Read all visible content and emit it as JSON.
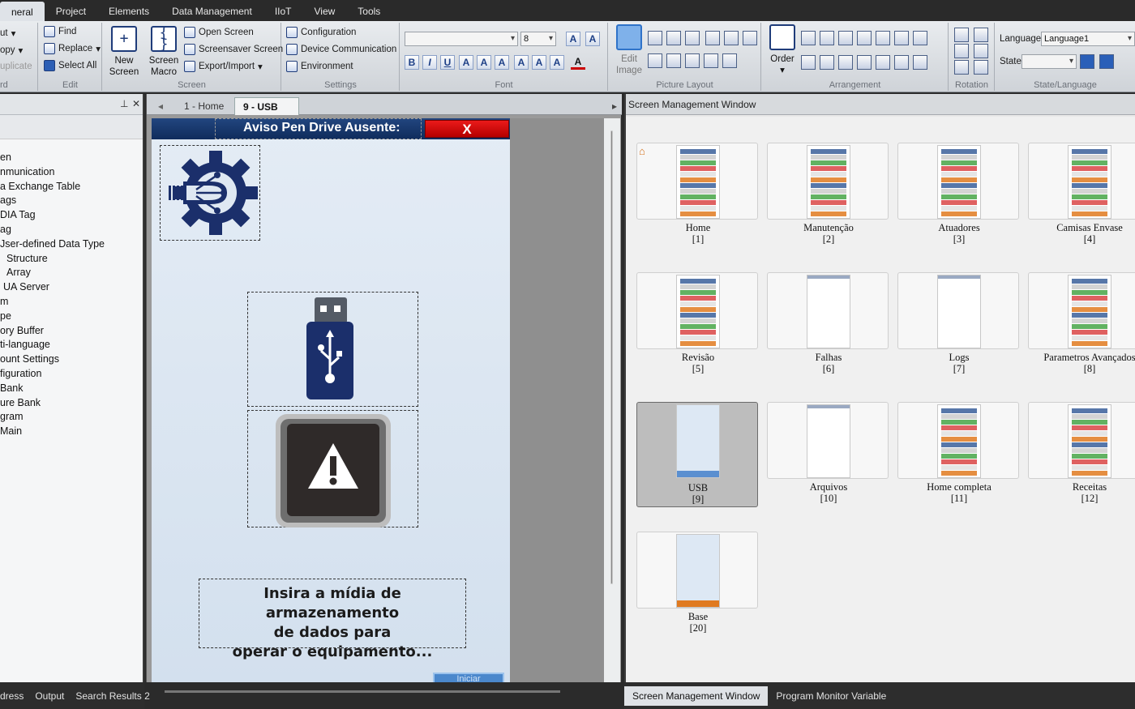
{
  "menubar": {
    "items": [
      "neral",
      "Project",
      "Elements",
      "Data Management",
      "IIoT",
      "View",
      "Tools"
    ]
  },
  "ribbon": {
    "clipboard": {
      "cut": "ut",
      "copy": "opy",
      "duplicate": "uplicate",
      "label": "rd"
    },
    "edit": {
      "find": "Find",
      "replace": "Replace",
      "select_all": "Select All",
      "label": "Edit"
    },
    "screen": {
      "new_screen": "New Screen",
      "screen_macro": "Screen Macro",
      "open_screen": "Open Screen",
      "screensaver": "Screensaver Screen",
      "export_import": "Export/Import",
      "label": "Screen"
    },
    "settings": {
      "configuration": "Configuration",
      "device_comm": "Device Communication",
      "environment": "Environment",
      "label": "Settings"
    },
    "font": {
      "size": "8",
      "label": "Font"
    },
    "picture_layout": {
      "edit_image": "Edit Image",
      "label": "Picture Layout"
    },
    "arrangement": {
      "order": "Order",
      "label": "Arrangement"
    },
    "rotation": {
      "label": "Rotation"
    },
    "state_language": {
      "language_label": "Language",
      "language_value": "Language1",
      "state_label": "State",
      "state_value": "",
      "label": "State/Language"
    }
  },
  "left_panel": {
    "tree": [
      "en",
      "nmunication",
      "a Exchange Table",
      "ags",
      "DIA Tag",
      "ag",
      "Jser-defined Data Type",
      "Structure",
      "Array",
      "UA Server",
      "m",
      "pe",
      "ory Buffer",
      "ti-language",
      "ount Settings",
      "figuration",
      "Bank",
      "ure Bank",
      "gram",
      "Main"
    ]
  },
  "bottom_left": {
    "tabs": [
      "dress",
      "Output",
      "Search Results 2"
    ]
  },
  "editor": {
    "tabs": [
      {
        "label": "1 - Home"
      },
      {
        "label": "9 - USB"
      }
    ],
    "close_glyph": "✕",
    "dialog_title": "Aviso Pen Drive Ausente:",
    "close_label": "X",
    "message_lines": [
      "Insira a mídia de armazenamento",
      "de dados para",
      "operar  o equipamento..."
    ],
    "start_label": "Iniciar"
  },
  "screen_management": {
    "title": "Screen Management Window",
    "screens": [
      {
        "name": "Home",
        "id": "[1]"
      },
      {
        "name": "Manutenção",
        "id": "[2]"
      },
      {
        "name": "Atuadores",
        "id": "[3]"
      },
      {
        "name": "Camisas Envase",
        "id": "[4]"
      },
      {
        "name": "Revisão",
        "id": "[5]"
      },
      {
        "name": "Falhas",
        "id": "[6]"
      },
      {
        "name": "Logs",
        "id": "[7]"
      },
      {
        "name": "Parametros Avançados",
        "id": "[8]"
      },
      {
        "name": "USB",
        "id": "[9]"
      },
      {
        "name": "Arquivos",
        "id": "[10]"
      },
      {
        "name": "Home completa",
        "id": "[11]"
      },
      {
        "name": "Receitas",
        "id": "[12]"
      },
      {
        "name": "Base",
        "id": "[20]"
      }
    ],
    "selected_screen": "USB"
  },
  "bottom_right": {
    "tabs": [
      "Screen Management Window",
      "Program Monitor Variable"
    ]
  },
  "colors": {
    "dialog_title_bg": "#1a3a70",
    "close_red": "#d40000",
    "accent_orange": "#d4711c",
    "usb_navy": "#1b2f6b"
  }
}
